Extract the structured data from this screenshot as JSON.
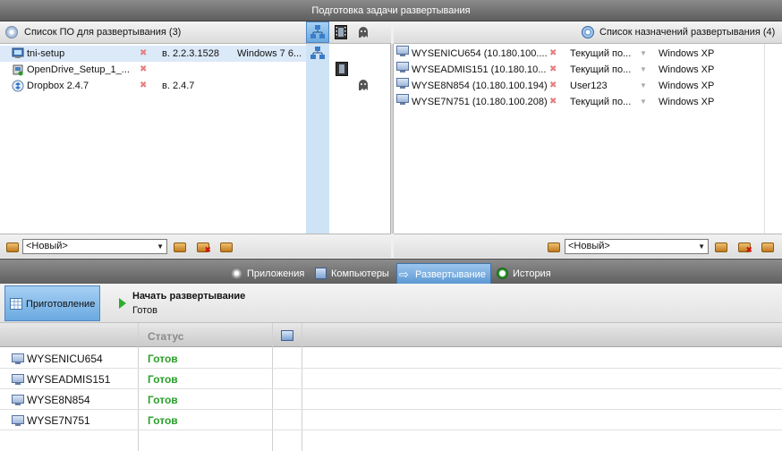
{
  "window": {
    "title": "Подготовка задачи развертывания"
  },
  "left_panel": {
    "title": "Список ПО для развертывания (3)",
    "items": [
      {
        "name": "tni-setup",
        "version": "в. 2.2.3.1528",
        "os": "Windows 7 6...",
        "icon": "installer-icon"
      },
      {
        "name": "OpenDrive_Setup_1_...",
        "version": "",
        "os": "",
        "icon": "installer-icon"
      },
      {
        "name": "Dropbox 2.4.7",
        "version": "в. 2.4.7",
        "os": "",
        "icon": "dropbox-installer-icon"
      }
    ],
    "profile_select": "<Новый>"
  },
  "right_panel": {
    "title": "Список назначений развертывания (4)",
    "items": [
      {
        "host": "WYSENICU654 (10.180.100....",
        "user": "Текущий по...",
        "os": "Windows XP"
      },
      {
        "host": "WYSEADMIS151 (10.180.10...",
        "user": "Текущий по...",
        "os": "Windows XP"
      },
      {
        "host": "WYSE8N854 (10.180.100.194)",
        "user": "User123",
        "os": "Windows XP"
      },
      {
        "host": "WYSE7N751 (10.180.100.208)",
        "user": "Текущий по...",
        "os": "Windows XP"
      }
    ],
    "profile_select": "<Новый>"
  },
  "tabs": [
    {
      "label": "Приложения"
    },
    {
      "label": "Компьютеры"
    },
    {
      "label": "Развертывание"
    },
    {
      "label": "История"
    }
  ],
  "action": {
    "prep_label": "Приготовление",
    "start_title": "Начать развертывание",
    "start_status": "Готов"
  },
  "grid": {
    "columns": {
      "status": "Статус"
    },
    "rows": [
      {
        "name": "WYSENICU654",
        "status": "Готов"
      },
      {
        "name": "WYSEADMIS151",
        "status": "Готов"
      },
      {
        "name": "WYSE8N854",
        "status": "Готов"
      },
      {
        "name": "WYSE7N751",
        "status": "Готов"
      }
    ]
  },
  "colors": {
    "accent": "#5c98d4",
    "ready": "#2aa02a",
    "remove": "#e28080"
  }
}
